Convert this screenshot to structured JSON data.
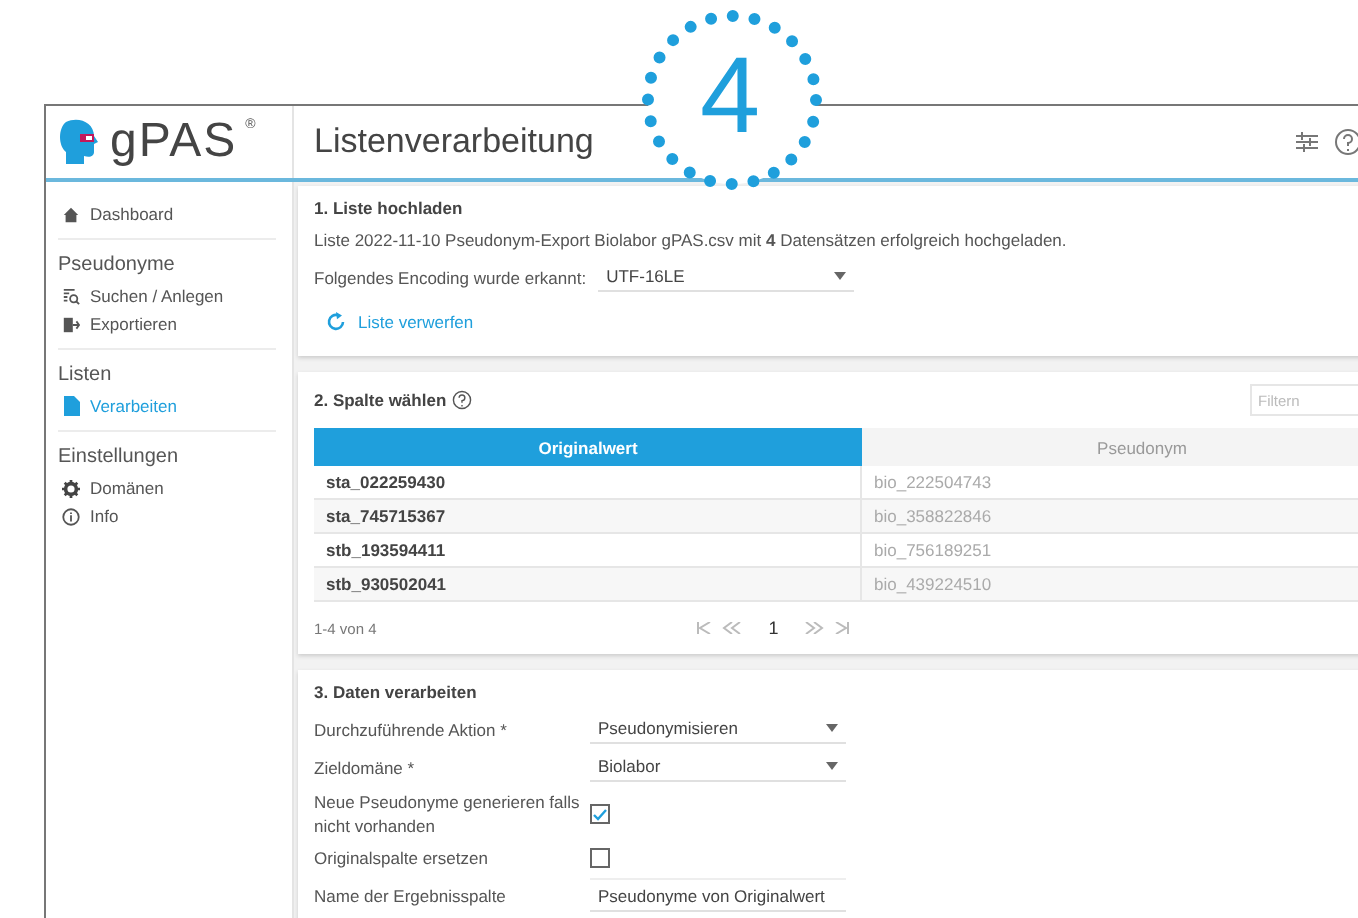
{
  "callout": {
    "number": "4"
  },
  "header": {
    "logo": "gPAS",
    "logo_mark": "®",
    "title": "Listenverarbeitung"
  },
  "sidebar": {
    "sections": [
      {
        "items": [
          {
            "label": "Dashboard",
            "kind": "home",
            "selected": false
          }
        ]
      },
      {
        "heading": "Pseudonyme",
        "items": [
          {
            "label": "Suchen / Anlegen",
            "kind": "search",
            "selected": false
          },
          {
            "label": "Exportieren",
            "kind": "export",
            "selected": false
          }
        ]
      },
      {
        "heading": "Listen",
        "items": [
          {
            "label": "Verarbeiten",
            "kind": "file",
            "selected": true
          }
        ]
      },
      {
        "heading": "Einstellungen",
        "items": [
          {
            "label": "Domänen",
            "kind": "gear",
            "selected": false
          },
          {
            "label": "Info",
            "kind": "info",
            "selected": false
          }
        ]
      }
    ]
  },
  "upload": {
    "title": "1. Liste hochladen",
    "message": "Liste 2022-11-10 Pseudonym-Export Biolabor gPAS.csv mit **4** Datensätzen erfolgreich hochgeladen.",
    "encoding_label": "Folgendes Encoding wurde erkannt:",
    "encoding_value": "UTF-16LE",
    "discard": "Liste verwerfen"
  },
  "column_select": {
    "title": "2. Spalte wählen",
    "filter_placeholder": "Filtern",
    "columns": [
      {
        "label": "Originalwert",
        "selected": true
      },
      {
        "label": "Pseudonym",
        "selected": false
      }
    ],
    "rows": [
      [
        "sta_022259430",
        "bio_222504743"
      ],
      [
        "sta_745715367",
        "bio_358822846"
      ],
      [
        "stb_193594411",
        "bio_756189251"
      ],
      [
        "stb_930502041",
        "bio_439224510"
      ]
    ],
    "range": "1-4 von 4",
    "page": "1"
  },
  "process": {
    "title": "3. Daten verarbeiten",
    "fields": [
      {
        "kind": "select",
        "label": "Durchzuführende Aktion *",
        "value": "Pseudonymisieren"
      },
      {
        "kind": "select",
        "label": "Zieldomäne *",
        "value": "Biolabor"
      },
      {
        "kind": "checkbox",
        "label": "Neue Pseudonyme generieren falls nicht vorhanden",
        "checked": true
      },
      {
        "kind": "checkbox",
        "label": "Originalspalte ersetzen",
        "checked": false
      },
      {
        "kind": "text",
        "label": "Name der Ergebnisspalte",
        "value": "Pseudonyme von Originalwert"
      }
    ]
  }
}
